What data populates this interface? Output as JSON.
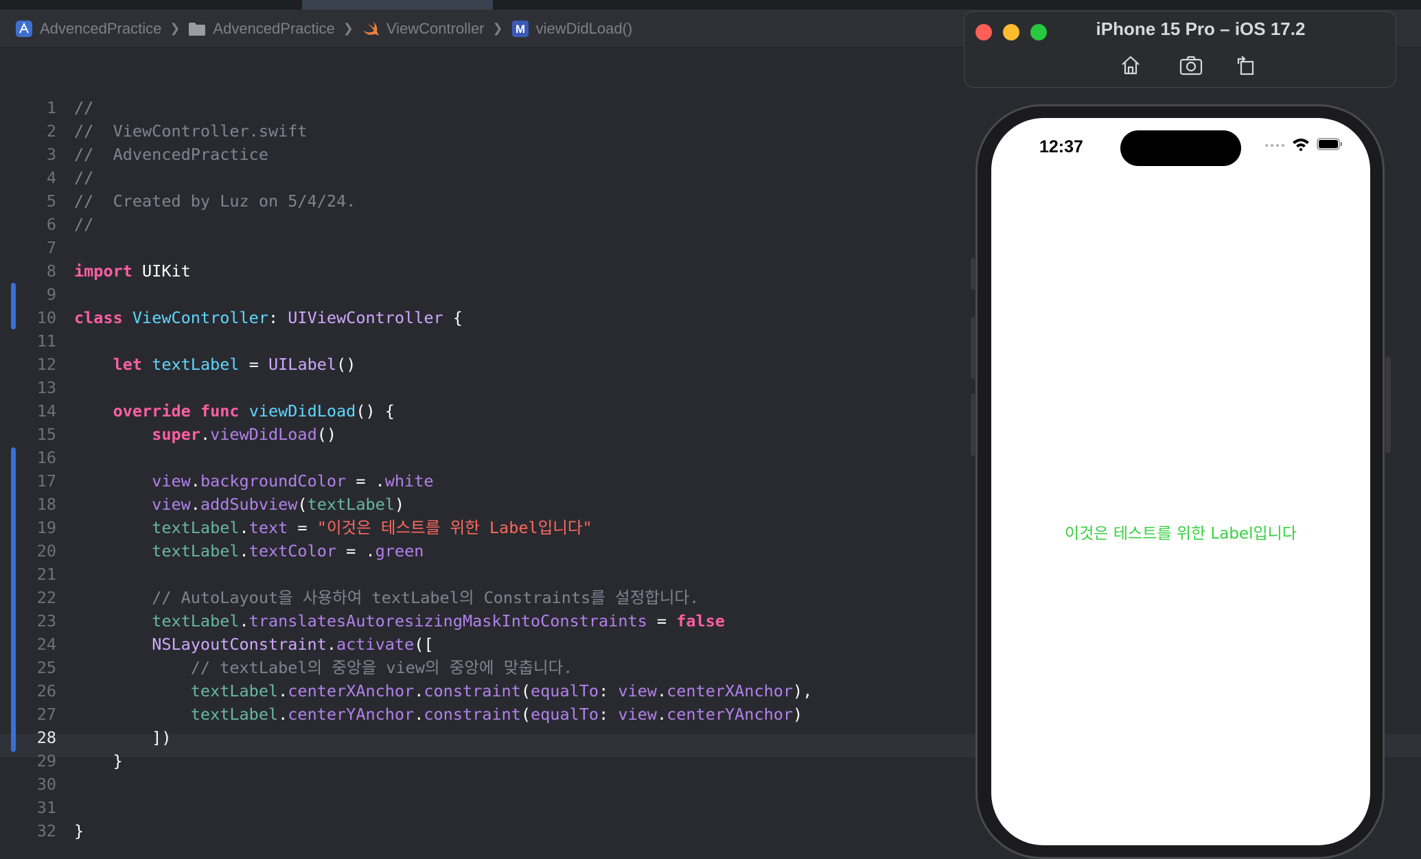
{
  "breadcrumb": [
    {
      "label": "AdvencedPractice",
      "icon": "xcode-project-icon"
    },
    {
      "label": "AdvencedPractice",
      "icon": "folder-icon"
    },
    {
      "label": "ViewController",
      "icon": "swift-file-icon"
    },
    {
      "label": "viewDidLoad()",
      "icon": "method-icon",
      "badge": "M"
    }
  ],
  "editor": {
    "current_line": 28,
    "lines": [
      {
        "n": "1",
        "tokens": [
          [
            "c-com",
            "//"
          ]
        ]
      },
      {
        "n": "2",
        "tokens": [
          [
            "c-com",
            "//  ViewController.swift"
          ]
        ]
      },
      {
        "n": "3",
        "tokens": [
          [
            "c-com",
            "//  AdvencedPractice"
          ]
        ]
      },
      {
        "n": "4",
        "tokens": [
          [
            "c-com",
            "//"
          ]
        ]
      },
      {
        "n": "5",
        "tokens": [
          [
            "c-com",
            "//  Created by Luz on 5/4/24."
          ]
        ]
      },
      {
        "n": "6",
        "tokens": [
          [
            "c-com",
            "//"
          ]
        ]
      },
      {
        "n": "7",
        "tokens": []
      },
      {
        "n": "8",
        "tokens": [
          [
            "c-kw",
            "import"
          ],
          [
            "c-plain",
            " UIKit"
          ]
        ]
      },
      {
        "n": "9",
        "tokens": []
      },
      {
        "n": "10",
        "tokens": [
          [
            "c-kw",
            "class"
          ],
          [
            "c-plain",
            " "
          ],
          [
            "c-type",
            "ViewController"
          ],
          [
            "c-plain",
            ": "
          ],
          [
            "c-tyd",
            "UIViewController"
          ],
          [
            "c-plain",
            " {"
          ]
        ]
      },
      {
        "n": "11",
        "tokens": []
      },
      {
        "n": "12",
        "tokens": [
          [
            "c-plain",
            "    "
          ],
          [
            "c-kw",
            "let"
          ],
          [
            "c-plain",
            " "
          ],
          [
            "c-type",
            "textLabel"
          ],
          [
            "c-plain",
            " = "
          ],
          [
            "c-tyd",
            "UILabel"
          ],
          [
            "c-plain",
            "()"
          ]
        ]
      },
      {
        "n": "13",
        "tokens": []
      },
      {
        "n": "14",
        "tokens": [
          [
            "c-plain",
            "    "
          ],
          [
            "c-kw",
            "override"
          ],
          [
            "c-plain",
            " "
          ],
          [
            "c-kw",
            "func"
          ],
          [
            "c-plain",
            " "
          ],
          [
            "c-type",
            "viewDidLoad"
          ],
          [
            "c-plain",
            "() {"
          ]
        ]
      },
      {
        "n": "15",
        "tokens": [
          [
            "c-plain",
            "        "
          ],
          [
            "c-kw",
            "super"
          ],
          [
            "c-plain",
            "."
          ],
          [
            "c-mem",
            "viewDidLoad"
          ],
          [
            "c-plain",
            "()"
          ]
        ]
      },
      {
        "n": "16",
        "tokens": []
      },
      {
        "n": "17",
        "tokens": [
          [
            "c-plain",
            "        "
          ],
          [
            "c-mem",
            "view"
          ],
          [
            "c-plain",
            "."
          ],
          [
            "c-mem",
            "backgroundColor"
          ],
          [
            "c-plain",
            " = ."
          ],
          [
            "c-mem",
            "white"
          ]
        ]
      },
      {
        "n": "18",
        "tokens": [
          [
            "c-plain",
            "        "
          ],
          [
            "c-mem",
            "view"
          ],
          [
            "c-plain",
            "."
          ],
          [
            "c-mem",
            "addSubview"
          ],
          [
            "c-plain",
            "("
          ],
          [
            "c-prop",
            "textLabel"
          ],
          [
            "c-plain",
            ")"
          ]
        ]
      },
      {
        "n": "19",
        "tokens": [
          [
            "c-plain",
            "        "
          ],
          [
            "c-prop",
            "textLabel"
          ],
          [
            "c-plain",
            "."
          ],
          [
            "c-mem",
            "text"
          ],
          [
            "c-plain",
            " = "
          ],
          [
            "c-str",
            "\"이것은 테스트를 위한 Label입니다\""
          ]
        ]
      },
      {
        "n": "20",
        "tokens": [
          [
            "c-plain",
            "        "
          ],
          [
            "c-prop",
            "textLabel"
          ],
          [
            "c-plain",
            "."
          ],
          [
            "c-mem",
            "textColor"
          ],
          [
            "c-plain",
            " = ."
          ],
          [
            "c-mem",
            "green"
          ]
        ]
      },
      {
        "n": "21",
        "tokens": []
      },
      {
        "n": "22",
        "tokens": [
          [
            "c-plain",
            "        "
          ],
          [
            "c-com",
            "// AutoLayout을 사용하여 textLabel의 Constraints를 설정합니다."
          ]
        ]
      },
      {
        "n": "23",
        "tokens": [
          [
            "c-plain",
            "        "
          ],
          [
            "c-prop",
            "textLabel"
          ],
          [
            "c-plain",
            "."
          ],
          [
            "c-mem",
            "translatesAutoresizingMaskIntoConstraints"
          ],
          [
            "c-plain",
            " = "
          ],
          [
            "c-kw",
            "false"
          ]
        ]
      },
      {
        "n": "24",
        "tokens": [
          [
            "c-plain",
            "        "
          ],
          [
            "c-tyd",
            "NSLayoutConstraint"
          ],
          [
            "c-plain",
            "."
          ],
          [
            "c-mem",
            "activate"
          ],
          [
            "c-plain",
            "(["
          ]
        ]
      },
      {
        "n": "25",
        "tokens": [
          [
            "c-plain",
            "            "
          ],
          [
            "c-com",
            "// textLabel의 중앙을 view의 중앙에 맞춥니다."
          ]
        ]
      },
      {
        "n": "26",
        "tokens": [
          [
            "c-plain",
            "            "
          ],
          [
            "c-prop",
            "textLabel"
          ],
          [
            "c-plain",
            "."
          ],
          [
            "c-mem",
            "centerXAnchor"
          ],
          [
            "c-plain",
            "."
          ],
          [
            "c-mem",
            "constraint"
          ],
          [
            "c-plain",
            "("
          ],
          [
            "c-mem",
            "equalTo"
          ],
          [
            "c-plain",
            ": "
          ],
          [
            "c-mem",
            "view"
          ],
          [
            "c-plain",
            "."
          ],
          [
            "c-mem",
            "centerXAnchor"
          ],
          [
            "c-plain",
            "),"
          ]
        ]
      },
      {
        "n": "27",
        "tokens": [
          [
            "c-plain",
            "            "
          ],
          [
            "c-prop",
            "textLabel"
          ],
          [
            "c-plain",
            "."
          ],
          [
            "c-mem",
            "centerYAnchor"
          ],
          [
            "c-plain",
            "."
          ],
          [
            "c-mem",
            "constraint"
          ],
          [
            "c-plain",
            "("
          ],
          [
            "c-mem",
            "equalTo"
          ],
          [
            "c-plain",
            ": "
          ],
          [
            "c-mem",
            "view"
          ],
          [
            "c-plain",
            "."
          ],
          [
            "c-mem",
            "centerYAnchor"
          ],
          [
            "c-plain",
            ")"
          ]
        ]
      },
      {
        "n": "28",
        "tokens": [
          [
            "c-plain",
            "        ])"
          ]
        ]
      },
      {
        "n": "29",
        "tokens": [
          [
            "c-plain",
            "    }"
          ]
        ]
      },
      {
        "n": "30",
        "tokens": []
      },
      {
        "n": "31",
        "tokens": []
      },
      {
        "n": "32",
        "tokens": [
          [
            "c-plain",
            "}"
          ]
        ]
      }
    ]
  },
  "simulator": {
    "title": "iPhone 15 Pro – iOS 17.2",
    "toolbar": [
      "home-icon",
      "screenshot-icon",
      "rotate-icon"
    ],
    "status_time": "12:37",
    "label_text": "이것은 테스트를 위한 Label입니다",
    "label_color": "#35d13e"
  }
}
